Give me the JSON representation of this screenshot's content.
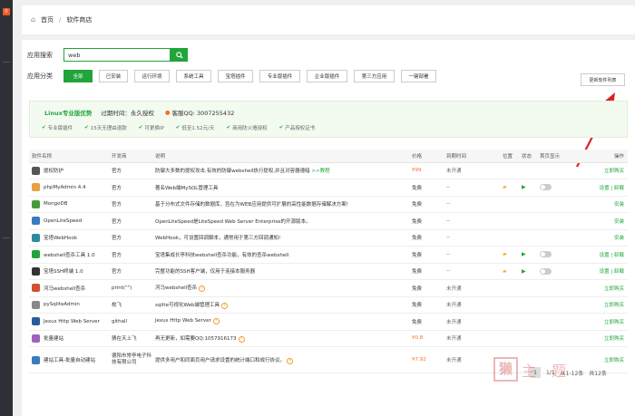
{
  "leftbar": {
    "badge": "0"
  },
  "breadcrumb": {
    "home": "首页",
    "sep": "/",
    "current": "软件商店"
  },
  "search": {
    "label": "应用搜索",
    "value": "web"
  },
  "categories": {
    "label": "应用分类",
    "items": [
      "全部",
      "已安装",
      "运行环境",
      "系统工具",
      "宝塔插件",
      "专业版插件",
      "企业版插件",
      "第三方应用",
      "一键部署"
    ],
    "active_index": 0
  },
  "refresh_label": "更新软件列表",
  "vip": {
    "title": "Linux专业版优势",
    "expire": "过期时间：永久授权",
    "qq": "客服QQ: 3007255432",
    "features": [
      "专业版插件",
      "15天无理由退款",
      "可更换IP",
      "低至1.52元/天",
      "商用防火墙授权",
      "产品授权证书"
    ]
  },
  "table": {
    "headers": [
      "软件名称",
      "开发商",
      "说明",
      "价格",
      "到期时间",
      "位置",
      "状态",
      "首页显示",
      "操作"
    ],
    "rows": [
      {
        "name": "提权防护",
        "dev": "官方",
        "desc": "防御大多数的提权攻击,有效的防御webshell执行提权,并且对容器遵暗",
        "desc_link": ">>教程",
        "price": "¥99",
        "expire": "未开通",
        "pos": false,
        "status": false,
        "toggle": false,
        "op": "立即购买",
        "icon_color": "#555"
      },
      {
        "name": "phpMyAdmin 4.4",
        "dev": "官方",
        "desc": "著名Web端MySQL管理工具",
        "price": "免费",
        "expire": "--",
        "pos": true,
        "status": true,
        "toggle": true,
        "op": "设置 | 卸载",
        "icon_color": "#e8a040"
      },
      {
        "name": "MongoDB",
        "dev": "官方",
        "desc": "基于分布式文件存储的数据库，旨在为WEB应用提供可扩展的高性能数据存储解决方案!",
        "price": "免费",
        "expire": "--",
        "pos": false,
        "status": false,
        "toggle": false,
        "op": "安装",
        "icon_color": "#4a9a3a"
      },
      {
        "name": "OpenLiteSpeed",
        "dev": "官方",
        "desc": "OpenLiteSpeed是LiteSpeed Web Server Enterprise的开源版本。",
        "price": "免费",
        "expire": "--",
        "pos": false,
        "status": false,
        "toggle": false,
        "op": "安装",
        "icon_color": "#3a7abf"
      },
      {
        "name": "宝塔WebHook",
        "dev": "官方",
        "desc": "WebHook，可设置回调脚本，通常用于第三方回调通知!",
        "price": "免费",
        "expire": "--",
        "pos": false,
        "status": false,
        "toggle": false,
        "op": "安装",
        "icon_color": "#2a8aa0"
      },
      {
        "name": "webshell查杀工具 1.0",
        "dev": "官方",
        "desc": "宝塔集成长亭科技webshell查杀功能，有效的查杀webshell",
        "price": "免费",
        "expire": "--",
        "pos": true,
        "status": true,
        "toggle": true,
        "op": "设置 | 卸载",
        "icon_color": "#20a53a"
      },
      {
        "name": "宝塔SSH终端 1.0",
        "dev": "官方",
        "desc": "完整功能的SSH客户端，仅用于连接本服务器",
        "price": "免费",
        "expire": "--",
        "pos": true,
        "status": true,
        "toggle": true,
        "op": "设置 | 卸载",
        "icon_color": "#333"
      },
      {
        "name": "河马webshell查杀",
        "dev": "print(\"\")",
        "desc": "河马webshell查杀",
        "help": true,
        "price": "免费",
        "expire": "未开通",
        "pos": false,
        "status": false,
        "toggle": false,
        "op": "立即购买",
        "icon_color": "#d05030"
      },
      {
        "name": "pySqliteAdmin",
        "dev": "枚飞",
        "desc": "sqlite可视化Web端管理工具",
        "help": true,
        "price": "免费",
        "expire": "未开通",
        "pos": false,
        "status": false,
        "toggle": false,
        "op": "立即购买",
        "icon_color": "#888"
      },
      {
        "name": "Jexus Http Web Server",
        "dev": "githall",
        "desc": "Jexus Http Web Server",
        "help": true,
        "price": "免费",
        "expire": "未开通",
        "pos": false,
        "status": false,
        "toggle": false,
        "op": "立即购买",
        "icon_color": "#2a5a9a"
      },
      {
        "name": "批量建站",
        "dev": "猜在天上飞",
        "desc": "再无更新，如需要QQ:1057916173",
        "help": true,
        "price": "¥0.8",
        "expire": "未开通",
        "pos": false,
        "status": false,
        "toggle": false,
        "op": "立即购买",
        "icon_color": "#a060c0"
      },
      {
        "name": "建站工具-批量自动建站",
        "dev": "德阳市常亭电子科技有限公司",
        "desc": "提供多用户和同面页用户请求设置的统计端口和成行协议。",
        "help": true,
        "price": "¥7.92",
        "expire": "未开通",
        "pos": false,
        "status": false,
        "toggle": false,
        "op": "立即购买",
        "icon_color": "#3a7abf",
        "tall": true
      }
    ]
  },
  "pager": {
    "current": "1",
    "total_pages": "1/1",
    "range": "从1-12条",
    "total": "共12条"
  },
  "watermark": {
    "seal": "獭",
    "text": "主 题"
  }
}
